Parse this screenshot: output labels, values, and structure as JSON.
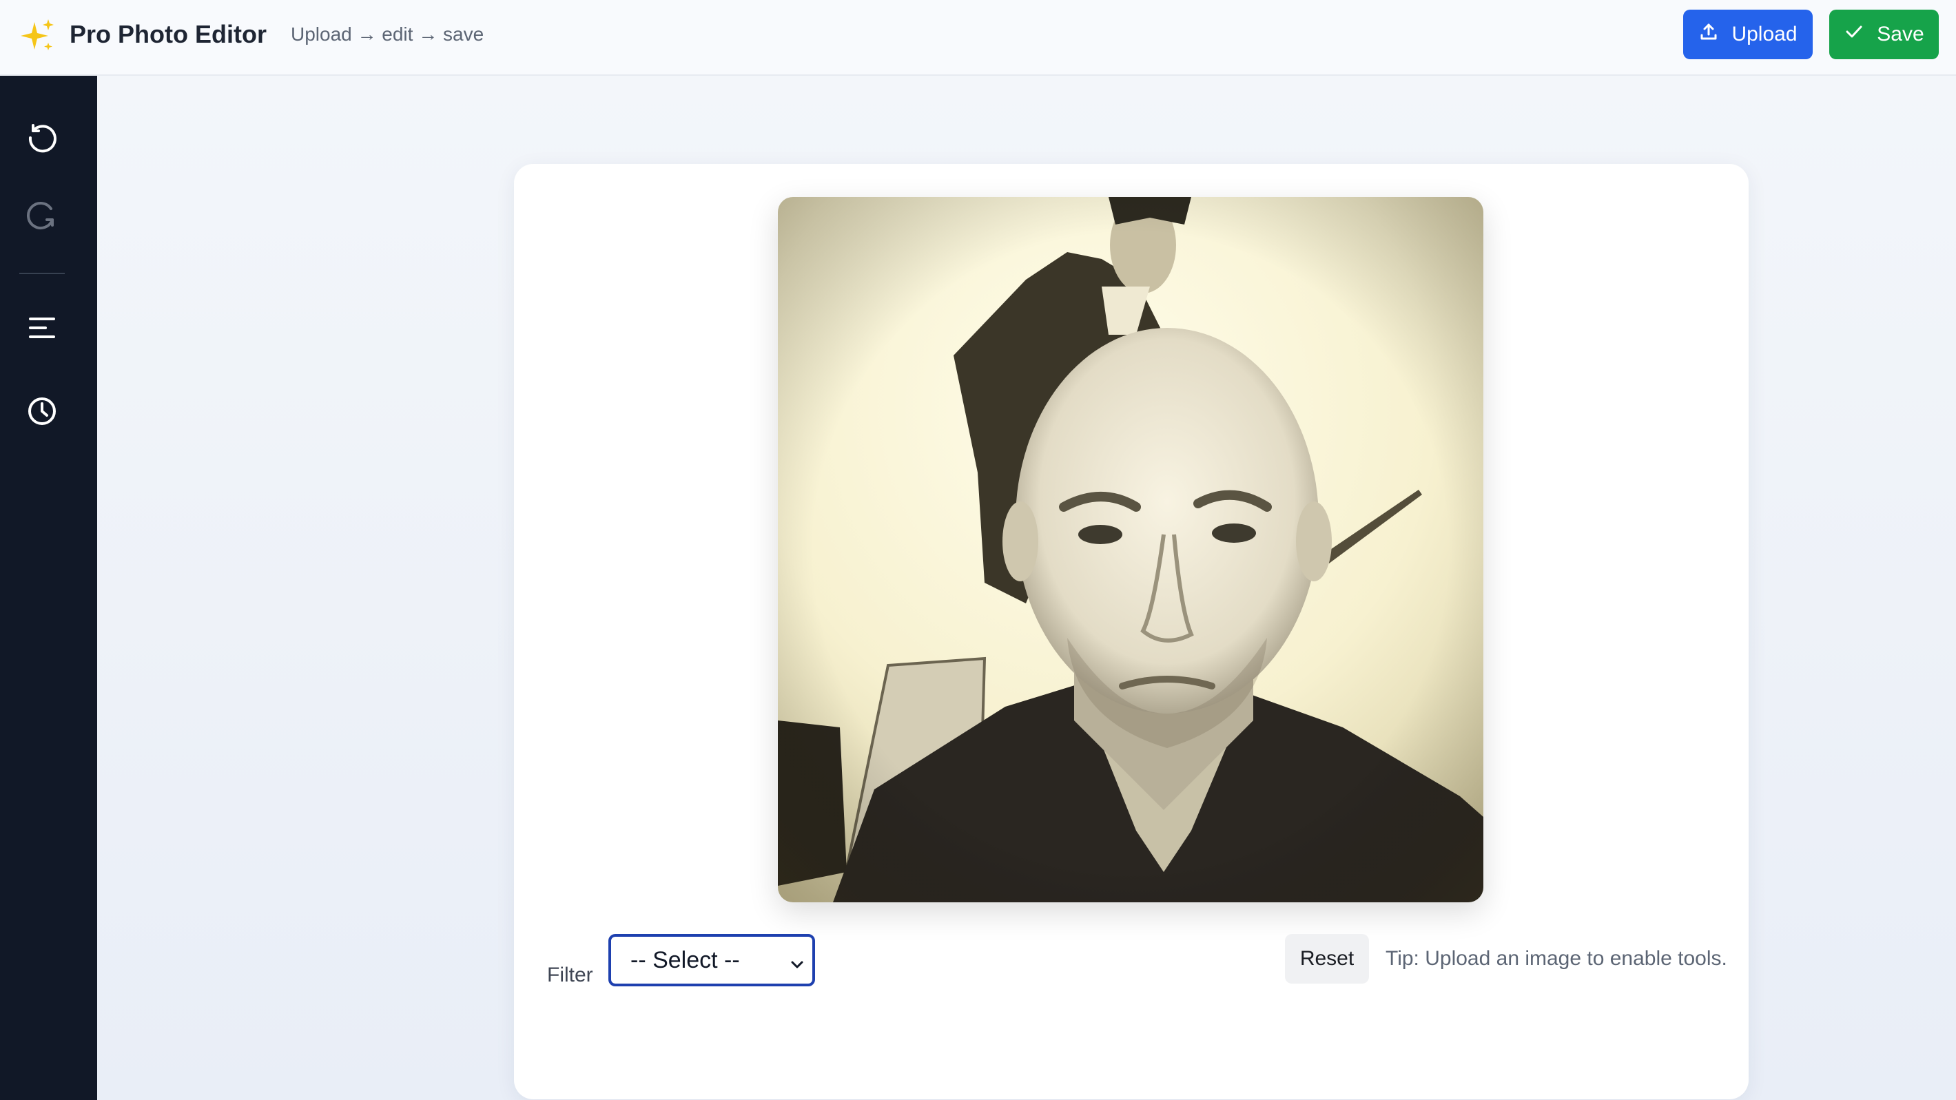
{
  "header": {
    "logo_icon": "sparkles-icon",
    "title": "Pro Photo Editor",
    "subtitle": "Upload → edit → save",
    "upload_label": "Upload",
    "upload_icon": "upload-icon",
    "save_label": "Save",
    "save_icon": "check-icon",
    "upload_color": "#2563eb",
    "save_color": "#16a34a"
  },
  "sidebar": {
    "items": [
      {
        "icon": "rotate-left-icon",
        "enabled": true
      },
      {
        "icon": "rotate-right-icon",
        "enabled": false
      },
      {
        "icon": "align-left-icon",
        "enabled": true
      },
      {
        "icon": "clock-icon",
        "enabled": true
      }
    ],
    "background": "#111827"
  },
  "editor": {
    "photo": "portrait-photo",
    "filter_label": "Filter",
    "filter_value": "-- Select --",
    "reset_label": "Reset",
    "tip": "Tip: Upload an image to enable tools."
  }
}
